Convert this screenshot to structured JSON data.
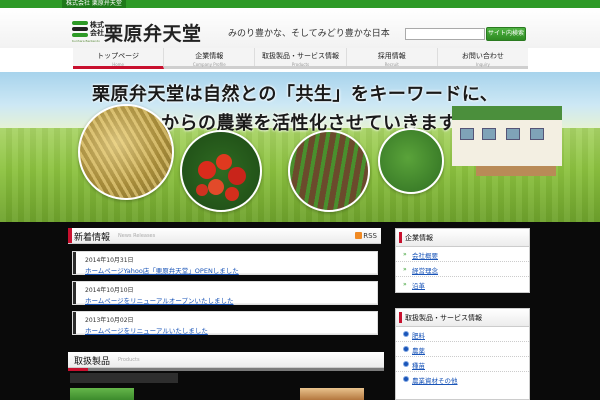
{
  "topbar": {
    "label": "株式会社 栗原弁天堂"
  },
  "header": {
    "logo_small": "Kurihara Bentendo",
    "company_prefix": "株式会社",
    "company_name": "栗原弁天堂",
    "tagline": "みのり豊かな、そしてみどり豊かな日本",
    "search_placeholder": "",
    "search_button": "サイト内検索"
  },
  "nav": {
    "items": [
      {
        "label": "トップページ",
        "en": "Home"
      },
      {
        "label": "企業情報",
        "en": "Company Profile"
      },
      {
        "label": "取扱製品・サービス情報",
        "en": "Products"
      },
      {
        "label": "採用情報",
        "en": "Recruit"
      },
      {
        "label": "お問い合わせ",
        "en": "Inquiry"
      }
    ]
  },
  "hero": {
    "line1": "栗原弁天堂は自然との「共生」をキーワードに、",
    "line2": "これからの農業を活性化させていきます。"
  },
  "news": {
    "title": "新着情報",
    "en": "News Releases",
    "rss": "RSS",
    "items": [
      {
        "date": "2014年10月31日",
        "text": "ホームページYahoo店「栗原弁天堂」OPENしました"
      },
      {
        "date": "2014年10月10日",
        "text": "ホームページをリニューアルオープンいたしました"
      },
      {
        "date": "2013年10月02日",
        "text": "ホームページをリニューアルいたしました"
      }
    ]
  },
  "products": {
    "title": "取扱製品",
    "en": "Products"
  },
  "sidebar": {
    "box1": {
      "title": "企業情報",
      "items": [
        "会社概要",
        "経営理念",
        "沿革"
      ]
    },
    "box2": {
      "title": "取扱製品・サービス情報",
      "items": [
        "肥料",
        "農薬",
        "種苗",
        "農業資材その他"
      ]
    }
  },
  "colors": {
    "brand_green": "#2e9a27",
    "accent_red": "#c8102e",
    "link_blue": "#1a55b8"
  }
}
